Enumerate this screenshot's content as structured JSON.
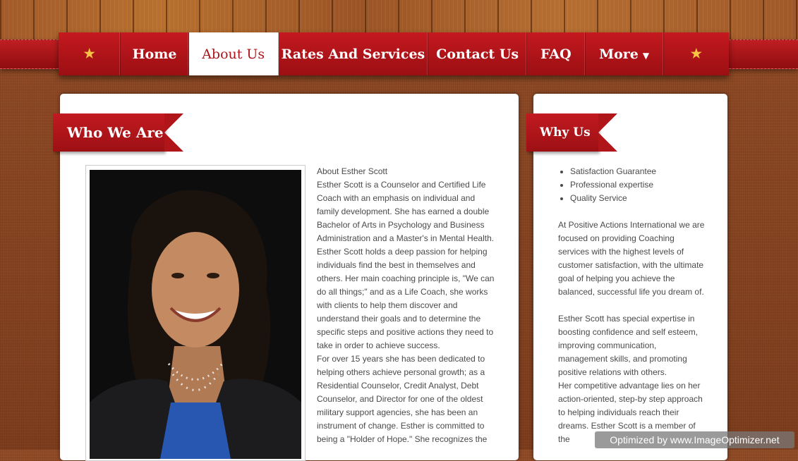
{
  "nav": {
    "items": [
      {
        "label": "Home"
      },
      {
        "label": "About Us"
      },
      {
        "label": "Rates And Services"
      },
      {
        "label": "Contact Us"
      },
      {
        "label": "FAQ"
      },
      {
        "label": "More"
      }
    ],
    "active": "About Us"
  },
  "main": {
    "heading": "Who We Are",
    "paragraphs": [
      "About  Esther Scott",
      "Esther Scott is a Counselor and Certified Life Coach with an emphasis on individual and family development.  She has earned a double Bachelor of Arts in Psychology and Business Administration and a Master's in Mental Health.   Esther Scott holds a deep passion for helping individuals find the best in themselves and others.   Her main coaching principle is, \"We can do all things;\" and as a Life Coach, she works with clients to help them discover and understand their goals and to determine the specific steps and positive actions they need to take in order to achieve success.",
      "For over 15 years she has been dedicated to helping others achieve personal growth; as a Residential Counselor, Credit Analyst, Debt Counselor, and Director for one of the oldest military support agencies, she has been an instrument of change. Esther is committed to being a \"Holder of Hope.\"   She recognizes the"
    ]
  },
  "sidebar": {
    "heading": "Why Us",
    "bullets": [
      "Satisfaction Guarantee",
      "Professional expertise",
      "Quality Service"
    ],
    "para1": "At Positive Actions International we are focused on providing Coaching services with the highest levels of customer satisfaction, with the ultimate goal of helping you achieve the  balanced, successful life you dream of.",
    "para2": "Esther Scott has special expertise in boosting confidence and self esteem, improving communication,  management skills, and promoting positive relations with others.",
    "para3": " Her competitive advantage lies on her action-oriented, step-by step approach to helping individuals reach their dreams.  Esther Scott is a member of the"
  },
  "watermark": "Optimized by www.ImageOptimizer.net",
  "colors": {
    "accent": "#b0151a",
    "text": "#4a4a4a"
  }
}
